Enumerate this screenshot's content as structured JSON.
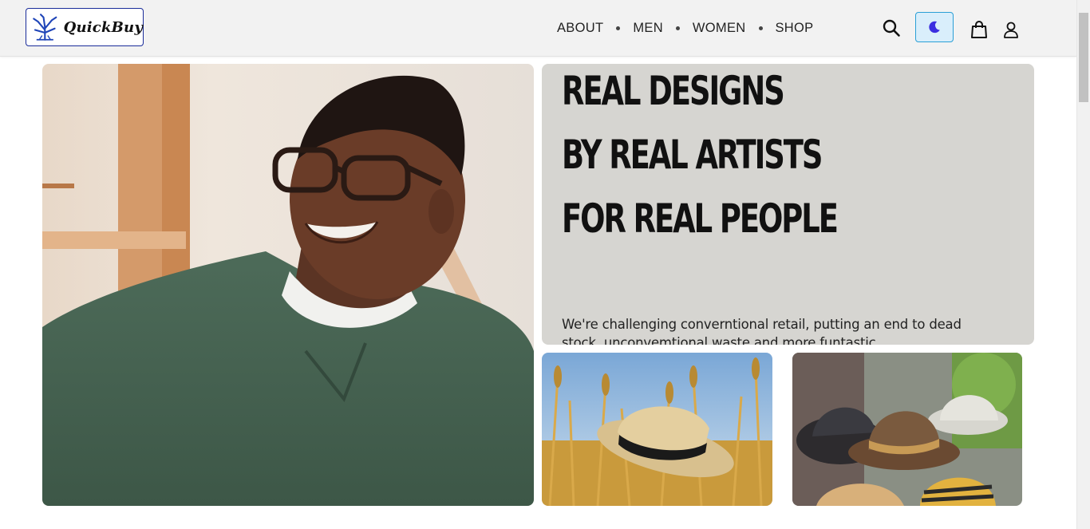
{
  "header": {
    "logo_text": "QuickBuy",
    "nav": [
      {
        "label": "ABOUT"
      },
      {
        "label": "MEN"
      },
      {
        "label": "WOMEN"
      },
      {
        "label": "SHOP"
      }
    ],
    "icons": [
      "search-icon",
      "moon-icon",
      "shopping-bag-icon",
      "user-icon"
    ]
  },
  "hero": {
    "lines": [
      "REAL DESIGNS",
      "BY REAL ARTISTS",
      "FOR REAL PEOPLE"
    ],
    "subtitle": "We're challenging converntional retail, putting an end to dead stock, unconvemtional waste and more funtastic"
  },
  "colors": {
    "accent": "#2a9fd6",
    "theme_button_bg": "#d9eefb",
    "moon": "#3b2ee0",
    "promo_bg": "#d6d5d1",
    "logo_border": "#1a2c9a"
  }
}
